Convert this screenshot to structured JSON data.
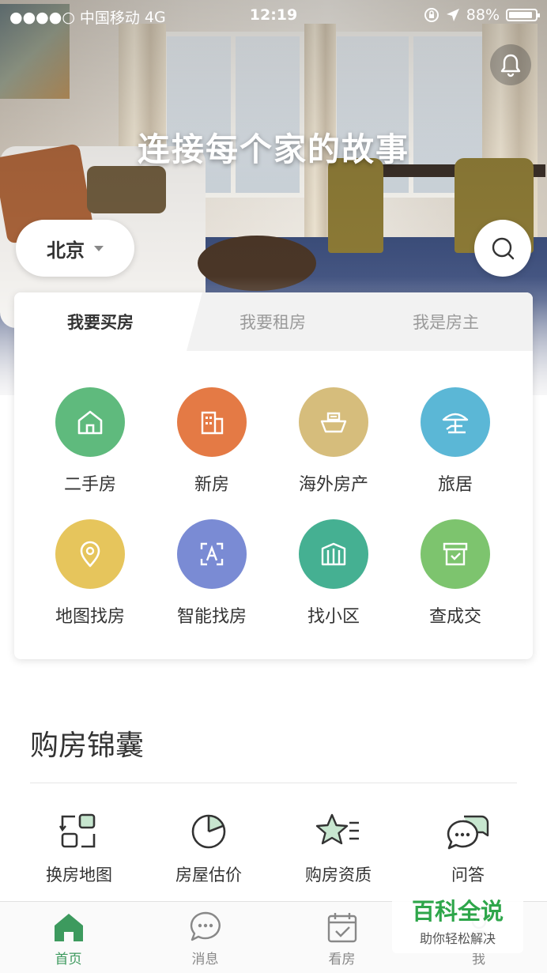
{
  "status_bar": {
    "carrier": "中国移动",
    "network": "4G",
    "time": "12:19",
    "battery": "88%"
  },
  "hero": {
    "slogan": "连接每个家的故事",
    "city": "北京"
  },
  "tabs": [
    {
      "label": "我要买房",
      "active": true
    },
    {
      "label": "我要租房",
      "active": false
    },
    {
      "label": "我是房主",
      "active": false
    }
  ],
  "categories": [
    {
      "label": "二手房",
      "icon": "house-icon",
      "color": "#5fba7d"
    },
    {
      "label": "新房",
      "icon": "building-icon",
      "color": "#e47a45"
    },
    {
      "label": "海外房产",
      "icon": "ship-icon",
      "color": "#d6bd7c"
    },
    {
      "label": "旅居",
      "icon": "beach-umbrella-icon",
      "color": "#5bb7d6"
    },
    {
      "label": "地图找房",
      "icon": "map-pin-icon",
      "color": "#e6c55c"
    },
    {
      "label": "智能找房",
      "icon": "smart-search-icon",
      "color": "#7a8bd4"
    },
    {
      "label": "找小区",
      "icon": "community-icon",
      "color": "#45b092"
    },
    {
      "label": "查成交",
      "icon": "deal-box-icon",
      "color": "#7dc46e"
    }
  ],
  "guide": {
    "title": "购房锦囊",
    "tools": [
      {
        "label": "换房地图",
        "icon": "swap-map-icon"
      },
      {
        "label": "房屋估价",
        "icon": "pie-chart-icon"
      },
      {
        "label": "购房资质",
        "icon": "star-list-icon"
      },
      {
        "label": "问答",
        "icon": "chat-bubbles-icon"
      }
    ]
  },
  "tabbar": [
    {
      "label": "首页",
      "icon": "home-icon",
      "active": true
    },
    {
      "label": "消息",
      "icon": "message-icon",
      "active": false
    },
    {
      "label": "看房",
      "icon": "calendar-check-icon",
      "active": false
    },
    {
      "label": "我",
      "icon": "profile-icon",
      "active": false
    }
  ],
  "watermark": {
    "title": "百科全说",
    "subtitle": "助你轻松解决"
  },
  "colors": {
    "brand_green": "#3d9a5e",
    "watermark_green": "#2ea64a"
  }
}
